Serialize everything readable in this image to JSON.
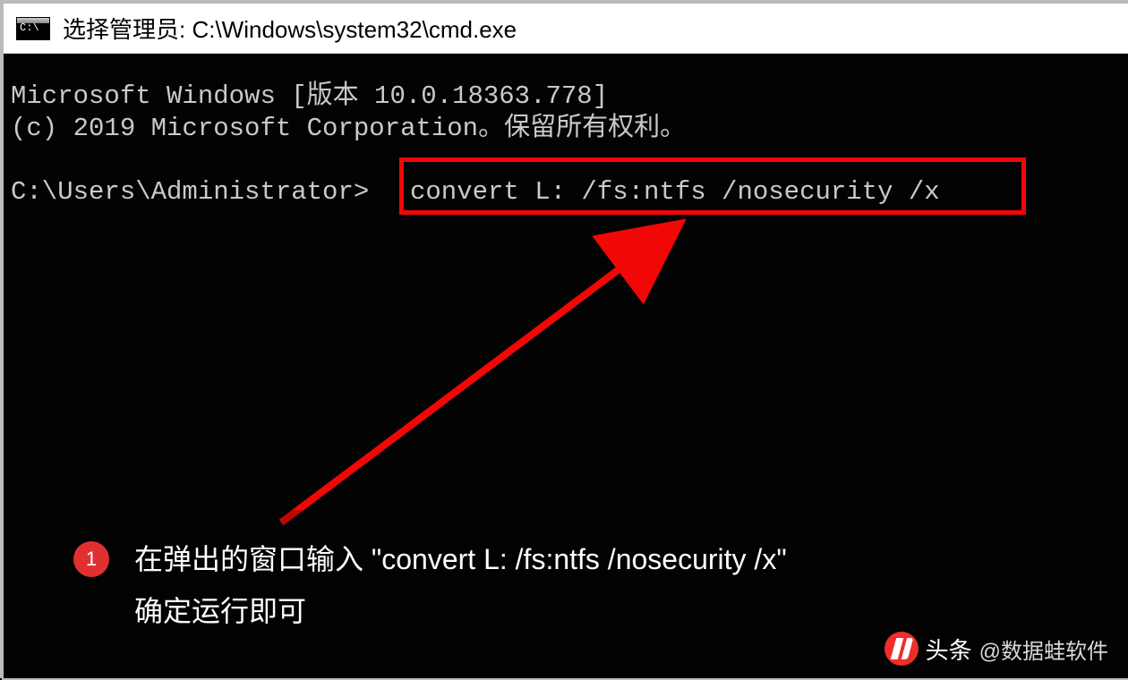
{
  "title": "选择管理员: C:\\Windows\\system32\\cmd.exe",
  "terminal": {
    "version_line": "Microsoft Windows [版本 10.0.18363.778]",
    "copyright_line": "(c) 2019 Microsoft Corporation。保留所有权利。",
    "prompt": "C:\\Users\\Administrator>",
    "command": "convert L: /fs:ntfs /nosecurity /x"
  },
  "callout": {
    "step_number": "1",
    "text": "在弹出的窗口输入 \"convert L: /fs:ntfs /nosecurity /x\"\n确定运行即可"
  },
  "watermark": {
    "prefix": "头条",
    "name": "@数据蛙软件"
  }
}
